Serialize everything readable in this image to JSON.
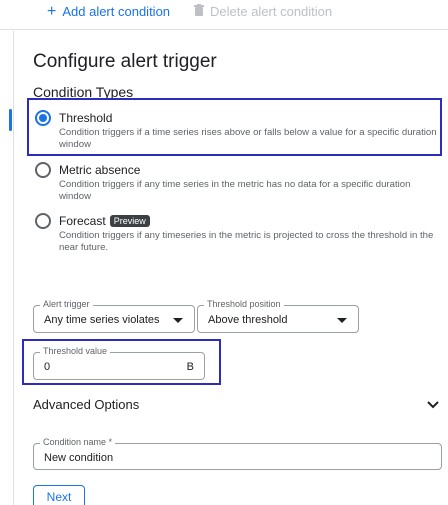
{
  "toolbar": {
    "add_label": "Add alert condition",
    "delete_label": "Delete alert condition"
  },
  "page": {
    "title": "Configure alert trigger"
  },
  "condition_types": {
    "heading": "Condition Types",
    "selected": "Threshold",
    "options": [
      {
        "label": "Threshold",
        "description": "Condition triggers if a time series rises above or falls below a value for a specific duration window",
        "checked": true
      },
      {
        "label": "Metric absence",
        "description": "Condition triggers if any time series in the metric has no data for a specific duration window",
        "checked": false
      },
      {
        "label": "Forecast",
        "badge": "Preview",
        "description": "Condition triggers if any timeseries in the metric is projected to cross the threshold in the near future.",
        "checked": false
      }
    ]
  },
  "fields": {
    "alert_trigger": {
      "label": "Alert trigger",
      "value": "Any time series violates"
    },
    "threshold_position": {
      "label": "Threshold position",
      "value": "Above threshold"
    },
    "threshold_value": {
      "label": "Threshold value",
      "value": "0",
      "unit": "B"
    },
    "condition_name": {
      "label": "Condition name *",
      "value": "New condition"
    }
  },
  "advanced": {
    "heading": "Advanced Options"
  },
  "actions": {
    "next_label": "Next"
  },
  "colors": {
    "accent": "#1a73e8",
    "highlight_border": "#2c2cbd"
  },
  "icons": {
    "add": "plus-icon",
    "delete": "trash-icon",
    "expand": "chevron-down-icon"
  }
}
